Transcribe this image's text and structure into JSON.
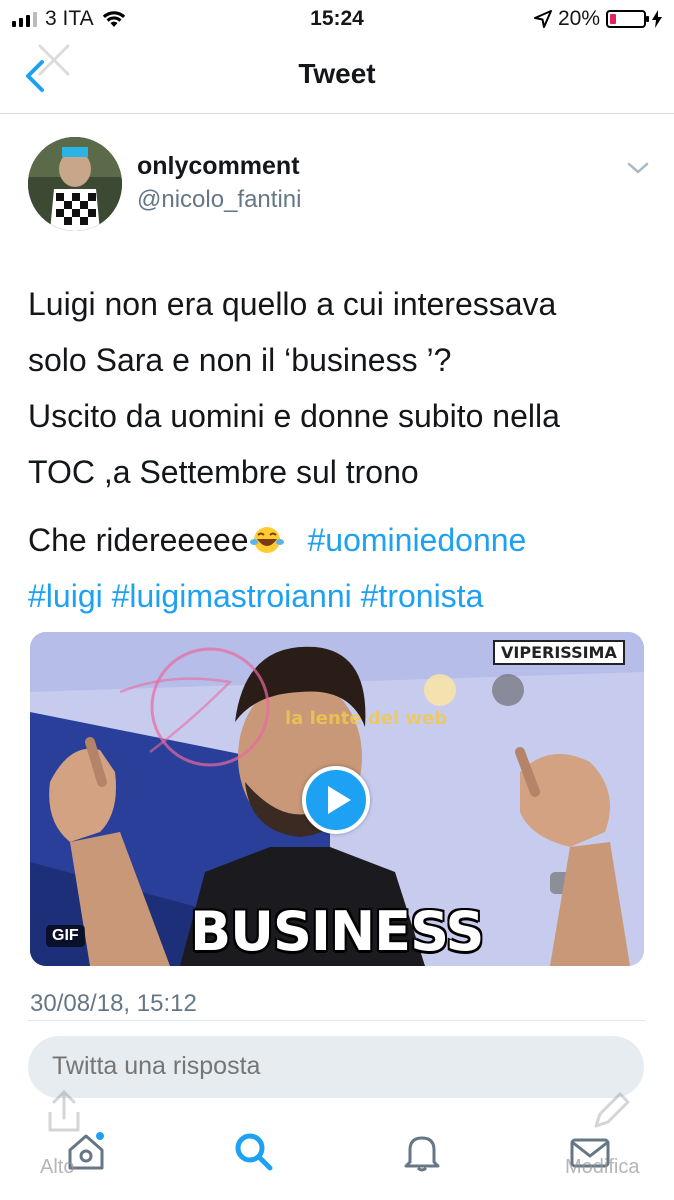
{
  "status_bar": {
    "carrier": "3 ITA",
    "time": "15:24",
    "battery_percent": "20%",
    "battery_level": 0.2
  },
  "nav": {
    "title": "Tweet",
    "back_icon": "chevron-left-icon",
    "close_icon": "close-icon"
  },
  "tweet": {
    "author_name": "onlycomment",
    "author_handle": "@nicolo_fantini",
    "text_lines": [
      "Luigi non era quello a cui interessava",
      "solo Sara e non il ‘business ’?",
      "Uscito da uomini e donne subito nella",
      "TOC ,a Settembre sul trono"
    ],
    "second_paragraph_start": "Che ridereeeee",
    "hashtags": [
      "#uominiedonne",
      "#luigi",
      "#luigimastroianni",
      "#tronista"
    ],
    "timestamp": "30/08/18, 15:12"
  },
  "media": {
    "type_badge": "GIF",
    "watermark": "VIPERISSIMA",
    "caption": "BUSINESS"
  },
  "reply": {
    "placeholder": "Twitta una risposta"
  },
  "overlay": {
    "left_label": "Alto",
    "right_label": "Modifica"
  },
  "tabs": [
    {
      "icon": "home-icon",
      "active": false,
      "has_dot": true
    },
    {
      "icon": "search-icon",
      "active": true
    },
    {
      "icon": "bell-icon",
      "active": false
    },
    {
      "icon": "mail-icon",
      "active": false
    }
  ],
  "colors": {
    "accent": "#1da1f2",
    "text": "#14171a",
    "muted": "#657786",
    "reply_bg": "#e6ecf0"
  }
}
